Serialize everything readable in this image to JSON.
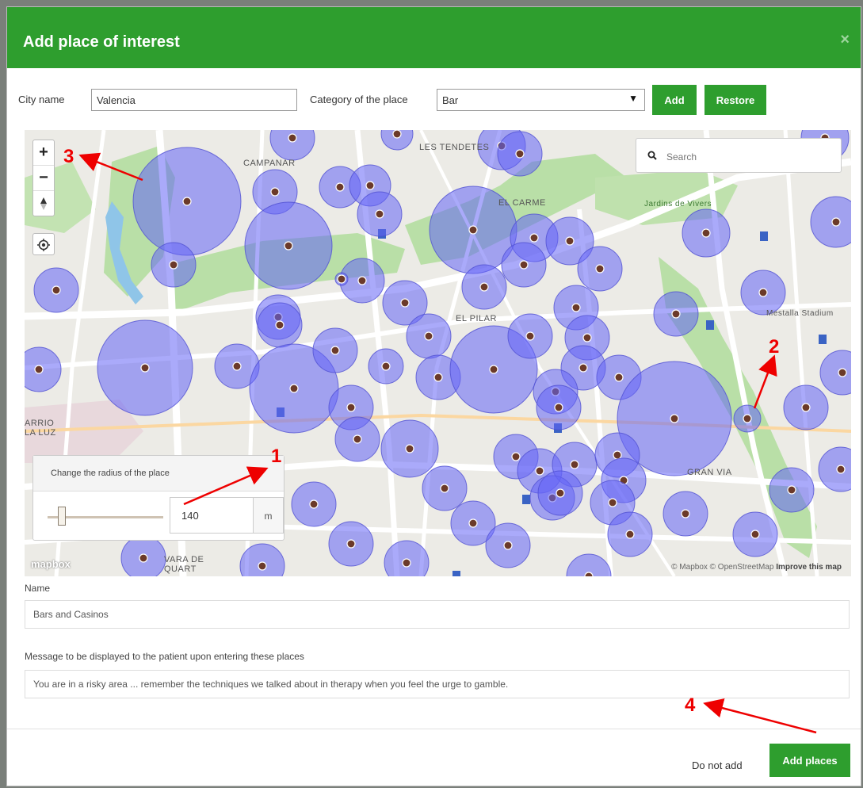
{
  "modal": {
    "title": "Add place of interest",
    "close_icon": "close-icon",
    "accent": "#2e9e2e"
  },
  "toolbar": {
    "city_label": "City name",
    "city_value": "Valencia",
    "category_label": "Category of the place",
    "category_value": "Bar",
    "add_label": "Add",
    "restore_label": "Restore"
  },
  "map": {
    "search_placeholder": "Search",
    "zoom_in": "+",
    "zoom_out": "−",
    "compass": "compass-icon",
    "locate": "locate-icon",
    "labels": [
      "LES TENDETES",
      "CAMPANAR",
      "EL CARME",
      "Jardins de Vivers",
      "EL PILAR",
      "Mestalla Stadium",
      "ARRIO LA LUZ",
      "GRAN VIA",
      "VARA DE QUART"
    ],
    "attribution": "© Mapbox © OpenStreetMap",
    "improve": "Improve this map",
    "logo": "mapbox"
  },
  "radius": {
    "title": "Change the radius of the place",
    "value": "140",
    "unit": "m",
    "slider_fraction": 0.12
  },
  "form": {
    "name_label": "Name",
    "name_value": "Bars and Casinos",
    "message_label": "Message to be displayed to the patient upon entering these places",
    "message_value": "You are in a risky area ... remember the techniques we talked about in therapy when you feel the urge to gamble."
  },
  "footer": {
    "cancel_label": "Do not add",
    "submit_label": "Add places"
  },
  "annotations": [
    "1",
    "2",
    "3",
    "4"
  ]
}
